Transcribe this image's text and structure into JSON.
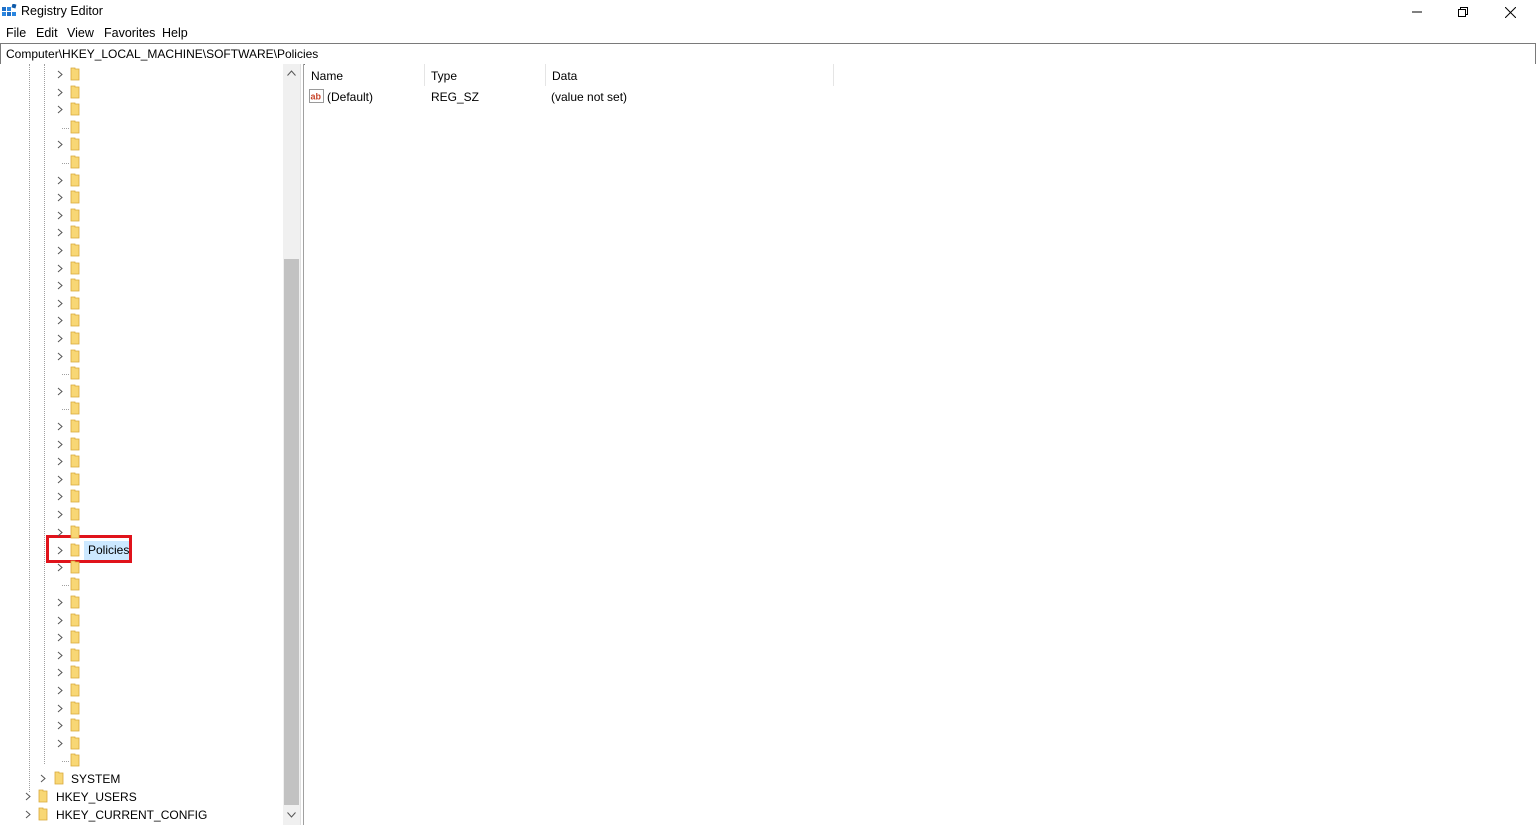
{
  "window": {
    "title": "Registry Editor"
  },
  "menu": [
    "File",
    "Edit",
    "View",
    "Favorites",
    "Help"
  ],
  "address": {
    "path": "Computer\\HKEY_LOCAL_MACHINE\\SOFTWARE\\Policies"
  },
  "tree": {
    "selected_label": "Policies",
    "system_label": "SYSTEM",
    "users_label": "HKEY_USERS",
    "current_config_label": "HKEY_CURRENT_CONFIG"
  },
  "list": {
    "columns": [
      "Name",
      "Type",
      "Data"
    ],
    "rows": [
      {
        "name": "(Default)",
        "type": "REG_SZ",
        "data": "(value not set)"
      }
    ]
  },
  "colors": {
    "selection": "#cce8ff",
    "highlight_border": "#e0131b",
    "folder": "#f8d775"
  }
}
